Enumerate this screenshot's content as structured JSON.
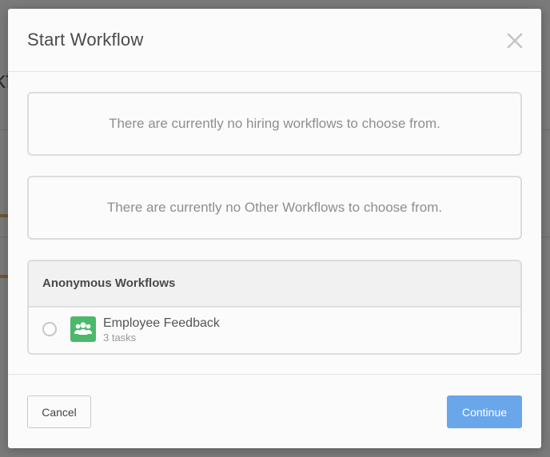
{
  "modal": {
    "title": "Start Workflow",
    "close_icon": "close-icon",
    "empty_hiring_message": "There are currently no hiring workflows to choose from.",
    "empty_other_message": "There are currently no Other Workflows to choose from.",
    "anonymous_section": {
      "heading": "Anonymous Workflows",
      "items": [
        {
          "name": "Employee Feedback",
          "tasks": "3 tasks",
          "icon": "group-icon",
          "icon_color": "#4cb86b",
          "selected": false
        }
      ]
    },
    "cancel_label": "Cancel",
    "continue_label": "Continue",
    "accent_color": "#6aa6ea"
  }
}
